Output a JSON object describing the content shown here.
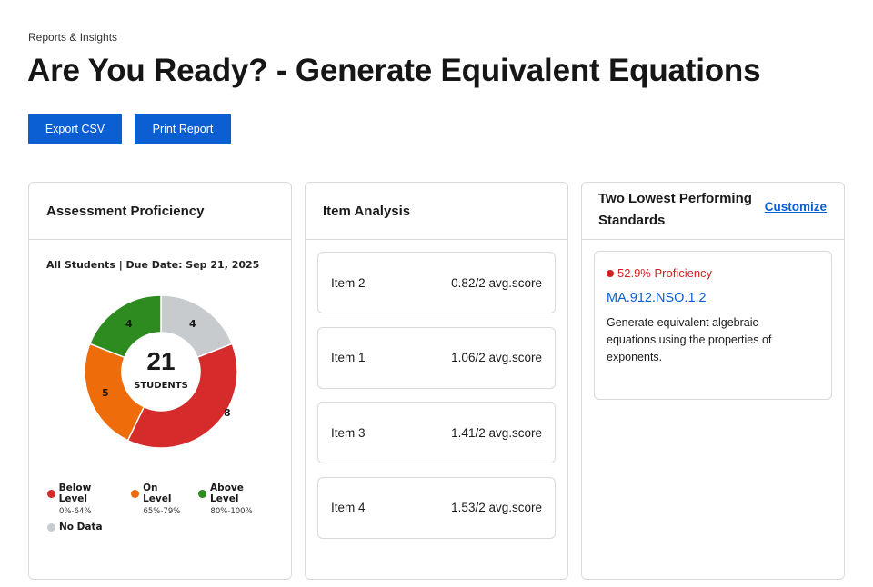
{
  "breadcrumb": "Reports & Insights",
  "title": "Are You Ready? - Generate Equivalent Equations",
  "actions": {
    "export_label": "Export CSV",
    "print_label": "Print Report"
  },
  "proficiency": {
    "header": "Assessment Proficiency",
    "subtitle": "All Students | Due Date: Sep 21, 2025",
    "total": "21",
    "total_label": "STUDENTS",
    "segments": [
      {
        "key": "no_data",
        "label": "No Data",
        "count": 4,
        "color": "#c8cbcd"
      },
      {
        "key": "below",
        "label": "Below Level",
        "count": 8,
        "color": "#d62b2b"
      },
      {
        "key": "on",
        "label": "On Level",
        "count": 5,
        "color": "#ee6d0a"
      },
      {
        "key": "above",
        "label": "Above Level",
        "count": 4,
        "color": "#2e8b20"
      }
    ],
    "legend": [
      {
        "label": "Below Level",
        "range": "0%-64%",
        "color": "#d62b2b"
      },
      {
        "label": "On Level",
        "range": "65%-79%",
        "color": "#ee6d0a"
      },
      {
        "label": "Above Level",
        "range": "80%-100%",
        "color": "#2e8b20"
      },
      {
        "label": "No Data",
        "range": "",
        "color": "#c8cbcd"
      }
    ],
    "segment_labels": {
      "no_data": "4",
      "below": "8",
      "on": "5",
      "above": "4"
    }
  },
  "item_analysis": {
    "header": "Item Analysis",
    "items": [
      {
        "name": "Item 2",
        "score": "0.82/2 avg.score"
      },
      {
        "name": "Item 1",
        "score": "1.06/2 avg.score"
      },
      {
        "name": "Item 3",
        "score": "1.41/2 avg.score"
      },
      {
        "name": "Item 4",
        "score": "1.53/2 avg.score"
      }
    ]
  },
  "standards": {
    "header": "Two Lowest Performing Standards",
    "customize_label": "Customize",
    "entries": [
      {
        "proficiency": "52.9% Proficiency",
        "code": "MA.912.NSO.1.2",
        "description": "Generate equivalent algebraic equations using the properties of exponents."
      }
    ]
  }
}
